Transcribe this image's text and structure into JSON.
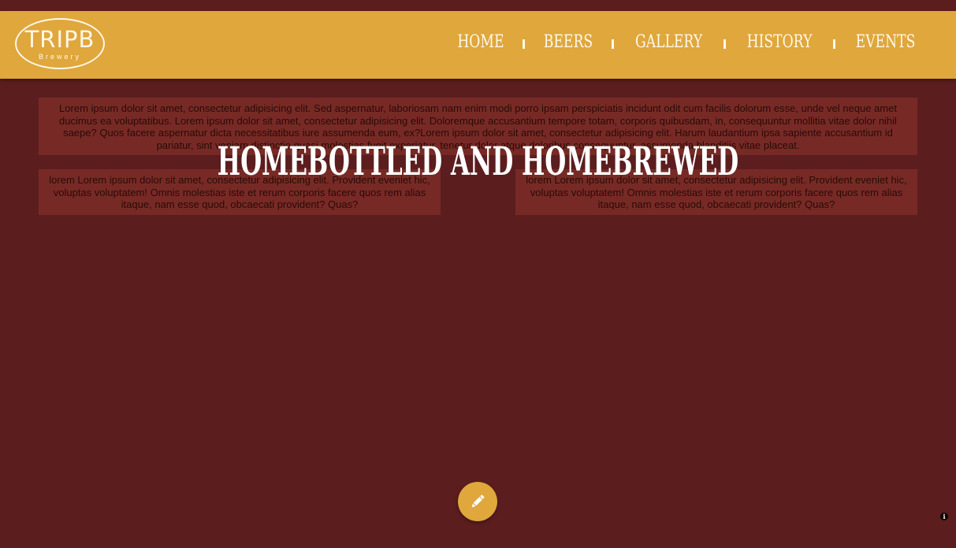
{
  "header": {
    "logo": {
      "main_text": "TRIPB",
      "sub_text": "Brewery"
    },
    "nav": [
      {
        "label": "HOME"
      },
      {
        "label": "BEERS"
      },
      {
        "label": "GALLERY"
      },
      {
        "label": "HISTORY"
      },
      {
        "label": "EVENTS"
      }
    ]
  },
  "main": {
    "hero_title": "HOMEBOTTLED AND HOMEBREWED",
    "top_paragraph": "Lorem ipsum dolor sit amet, consectetur adipisicing elit. Sed aspernatur, laboriosam nam enim modi porro ipsam perspiciatis incidunt odit cum facilis dolorum esse, unde vel neque amet ducimus ea voluptatibus. Lorem ipsum dolor sit amet, consectetur adipisicing elit. Doloremque accusantium tempore totam, corporis quibusdam, in, consequuntur mollitia vitae dolor nihil saepe? Quos facere aspernatur dicta necessitatibus iure assumenda eum, ex?Lorem ipsum dolor sit amet, consectetur adipisicing elit. Harum laudantium ipsa sapiente accusantium id pariatur, sint veniam distinctio quasi molestias fugit experiatur, tenetur dolor atque doloribus consequuntur, assumenda blanditiis vitae placeat.",
    "left_paragraph": "lorem Lorem ipsum dolor sit amet, consectetur adipisicing elit. Provident eveniet hic, voluptas voluptatem! Omnis molestias iste et rerum corporis facere quos rem alias itaque, nam esse quod, obcaecati provident? Quas?",
    "right_paragraph": "lorem Lorem ipsum dolor sit amet, consectetur adipisicing elit. Provident eveniet hic, voluptas voluptatem! Omnis molestias iste et rerum corporis facere quos rem alias itaque, nam esse quod, obcaecati provident? Quas?"
  },
  "fab": {
    "icon": "pencil-icon"
  },
  "corner": {
    "icon": "info-icon",
    "glyph": "i"
  },
  "colors": {
    "background": "#5b1d1e",
    "header": "#dfa73c",
    "nav_text": "#fff8ea",
    "hero_text": "#ffffff"
  }
}
